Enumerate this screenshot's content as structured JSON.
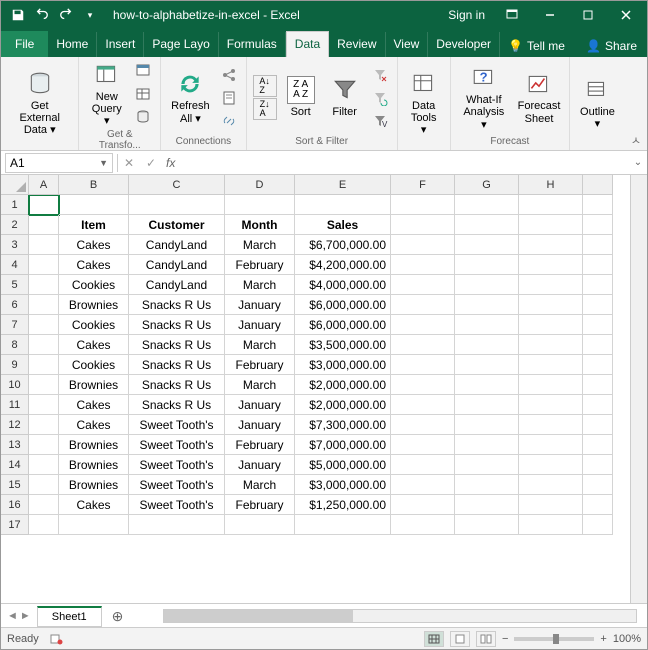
{
  "title": "how-to-alphabetize-in-excel - Excel",
  "signin": "Sign in",
  "tabs": {
    "file": "File",
    "home": "Home",
    "insert": "Insert",
    "pagelayout": "Page Layo",
    "formulas": "Formulas",
    "data": "Data",
    "review": "Review",
    "view": "View",
    "developer": "Developer",
    "tellme": "Tell me",
    "share": "Share"
  },
  "ribbon": {
    "getdata": "Get External\nData ▾",
    "newquery": "New\nQuery ▾",
    "refresh": "Refresh\nAll ▾",
    "sort": "Sort",
    "filter": "Filter",
    "datatools": "Data\nTools ▾",
    "whatif": "What-If\nAnalysis ▾",
    "forecast": "Forecast\nSheet",
    "outline": "Outline\n▾",
    "grp_transform": "Get & Transfo...",
    "grp_conn": "Connections",
    "grp_sort": "Sort & Filter",
    "grp_forecast": "Forecast"
  },
  "namebox": "A1",
  "colwidths": {
    "A": 30,
    "B": 70,
    "C": 96,
    "D": 70,
    "E": 96,
    "F": 64,
    "G": 64,
    "H": 64,
    "I": 30
  },
  "cols": [
    "A",
    "B",
    "C",
    "D",
    "E",
    "F",
    "G",
    "H"
  ],
  "headers": {
    "B": "Item",
    "C": "Customer",
    "D": "Month",
    "E": "Sales"
  },
  "rows": [
    {
      "n": 3,
      "B": "Cakes",
      "C": "CandyLand",
      "D": "March",
      "E": "$6,700,000.00"
    },
    {
      "n": 4,
      "B": "Cakes",
      "C": "CandyLand",
      "D": "February",
      "E": "$4,200,000.00"
    },
    {
      "n": 5,
      "B": "Cookies",
      "C": "CandyLand",
      "D": "March",
      "E": "$4,000,000.00"
    },
    {
      "n": 6,
      "B": "Brownies",
      "C": "Snacks R Us",
      "D": "January",
      "E": "$6,000,000.00"
    },
    {
      "n": 7,
      "B": "Cookies",
      "C": "Snacks R Us",
      "D": "January",
      "E": "$6,000,000.00"
    },
    {
      "n": 8,
      "B": "Cakes",
      "C": "Snacks R Us",
      "D": "March",
      "E": "$3,500,000.00"
    },
    {
      "n": 9,
      "B": "Cookies",
      "C": "Snacks R Us",
      "D": "February",
      "E": "$3,000,000.00"
    },
    {
      "n": 10,
      "B": "Brownies",
      "C": "Snacks R Us",
      "D": "March",
      "E": "$2,000,000.00"
    },
    {
      "n": 11,
      "B": "Cakes",
      "C": "Snacks R Us",
      "D": "January",
      "E": "$2,000,000.00"
    },
    {
      "n": 12,
      "B": "Cakes",
      "C": "Sweet Tooth's",
      "D": "January",
      "E": "$7,300,000.00"
    },
    {
      "n": 13,
      "B": "Brownies",
      "C": "Sweet Tooth's",
      "D": "February",
      "E": "$7,000,000.00"
    },
    {
      "n": 14,
      "B": "Brownies",
      "C": "Sweet Tooth's",
      "D": "January",
      "E": "$5,000,000.00"
    },
    {
      "n": 15,
      "B": "Brownies",
      "C": "Sweet Tooth's",
      "D": "March",
      "E": "$3,000,000.00"
    },
    {
      "n": 16,
      "B": "Cakes",
      "C": "Sweet Tooth's",
      "D": "February",
      "E": "$1,250,000.00"
    }
  ],
  "sheet": "Sheet1",
  "status": "Ready",
  "zoom": "100%"
}
